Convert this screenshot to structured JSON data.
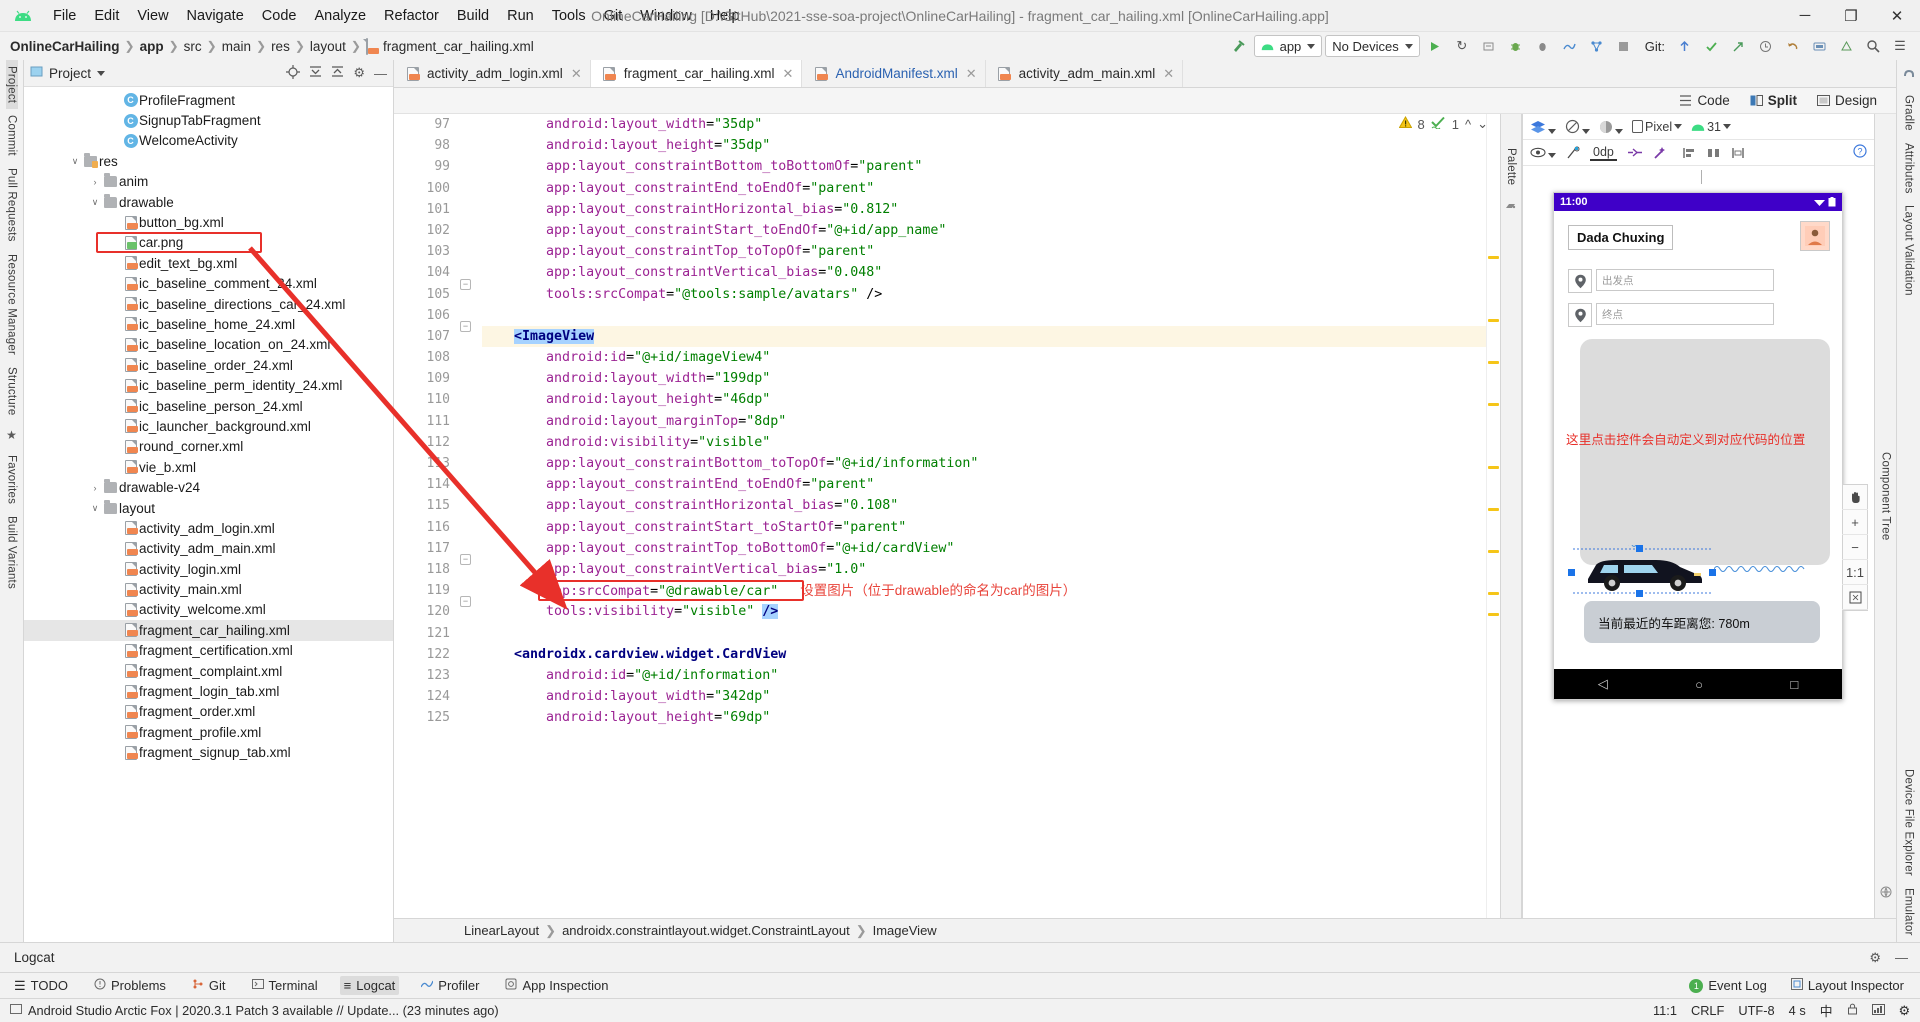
{
  "window": {
    "title": "OnlineCarHailing [D:\\GitHub\\2021-sse-soa-project\\OnlineCarHailing] - fragment_car_hailing.xml [OnlineCarHailing.app]",
    "minimize": "─",
    "maximize": "❐",
    "close": "✕"
  },
  "menu": [
    "File",
    "Edit",
    "View",
    "Navigate",
    "Code",
    "Analyze",
    "Refactor",
    "Build",
    "Run",
    "Tools",
    "Git",
    "Window",
    "Help"
  ],
  "breadcrumb": [
    "OnlineCarHailing",
    "app",
    "src",
    "main",
    "res",
    "layout",
    "fragment_car_hailing.xml"
  ],
  "toolbar": {
    "module_selector": "app",
    "device_selector": "No Devices",
    "git_label": "Git:"
  },
  "project_panel": {
    "title": "Project",
    "tree": [
      {
        "indent": 4,
        "arrow": "",
        "icon": "class-icon",
        "label": "ProfileFragment"
      },
      {
        "indent": 4,
        "arrow": "",
        "icon": "class-icon",
        "label": "SignupTabFragment"
      },
      {
        "indent": 4,
        "arrow": "",
        "icon": "class-icon",
        "label": "WelcomeActivity"
      },
      {
        "indent": 2,
        "arrow": "∨",
        "icon": "res-folder-icon",
        "label": "res"
      },
      {
        "indent": 3,
        "arrow": "›",
        "icon": "folder-icon",
        "label": "anim"
      },
      {
        "indent": 3,
        "arrow": "∨",
        "icon": "folder-icon",
        "label": "drawable"
      },
      {
        "indent": 4,
        "arrow": "",
        "icon": "xml-file-icon",
        "label": "button_bg.xml"
      },
      {
        "indent": 4,
        "arrow": "",
        "icon": "png-file-icon",
        "label": "car.png",
        "highlight": true
      },
      {
        "indent": 4,
        "arrow": "",
        "icon": "xml-file-icon",
        "label": "edit_text_bg.xml"
      },
      {
        "indent": 4,
        "arrow": "",
        "icon": "xml-file-icon",
        "label": "ic_baseline_comment_24.xml"
      },
      {
        "indent": 4,
        "arrow": "",
        "icon": "xml-file-icon",
        "label": "ic_baseline_directions_car_24.xml"
      },
      {
        "indent": 4,
        "arrow": "",
        "icon": "xml-file-icon",
        "label": "ic_baseline_home_24.xml"
      },
      {
        "indent": 4,
        "arrow": "",
        "icon": "xml-file-icon",
        "label": "ic_baseline_location_on_24.xml"
      },
      {
        "indent": 4,
        "arrow": "",
        "icon": "xml-file-icon",
        "label": "ic_baseline_order_24.xml"
      },
      {
        "indent": 4,
        "arrow": "",
        "icon": "xml-file-icon",
        "label": "ic_baseline_perm_identity_24.xml"
      },
      {
        "indent": 4,
        "arrow": "",
        "icon": "xml-file-icon",
        "label": "ic_baseline_person_24.xml"
      },
      {
        "indent": 4,
        "arrow": "",
        "icon": "xml-file-icon",
        "label": "ic_launcher_background.xml"
      },
      {
        "indent": 4,
        "arrow": "",
        "icon": "xml-file-icon",
        "label": "round_corner.xml"
      },
      {
        "indent": 4,
        "arrow": "",
        "icon": "xml-file-icon",
        "label": "vie_b.xml"
      },
      {
        "indent": 3,
        "arrow": "›",
        "icon": "folder-icon",
        "label": "drawable-v24"
      },
      {
        "indent": 3,
        "arrow": "∨",
        "icon": "folder-icon",
        "label": "layout"
      },
      {
        "indent": 4,
        "arrow": "",
        "icon": "xml-file-icon",
        "label": "activity_adm_login.xml"
      },
      {
        "indent": 4,
        "arrow": "",
        "icon": "xml-file-icon",
        "label": "activity_adm_main.xml"
      },
      {
        "indent": 4,
        "arrow": "",
        "icon": "xml-file-icon",
        "label": "activity_login.xml"
      },
      {
        "indent": 4,
        "arrow": "",
        "icon": "xml-file-icon",
        "label": "activity_main.xml"
      },
      {
        "indent": 4,
        "arrow": "",
        "icon": "xml-file-icon",
        "label": "activity_welcome.xml"
      },
      {
        "indent": 4,
        "arrow": "",
        "icon": "xml-file-icon",
        "label": "fragment_car_hailing.xml",
        "selected": true
      },
      {
        "indent": 4,
        "arrow": "",
        "icon": "xml-file-icon",
        "label": "fragment_certification.xml"
      },
      {
        "indent": 4,
        "arrow": "",
        "icon": "xml-file-icon",
        "label": "fragment_complaint.xml"
      },
      {
        "indent": 4,
        "arrow": "",
        "icon": "xml-file-icon",
        "label": "fragment_login_tab.xml"
      },
      {
        "indent": 4,
        "arrow": "",
        "icon": "xml-file-icon",
        "label": "fragment_order.xml"
      },
      {
        "indent": 4,
        "arrow": "",
        "icon": "xml-file-icon",
        "label": "fragment_profile.xml"
      },
      {
        "indent": 4,
        "arrow": "",
        "icon": "xml-file-icon",
        "label": "fragment_signup_tab.xml"
      }
    ]
  },
  "left_rail": [
    "Project",
    "Commit",
    "Pull Requests",
    "Resource Manager",
    "Structure",
    "Favorites",
    "Build Variants"
  ],
  "right_rail": [
    "Gradle",
    "Attributes",
    "Layout Validation",
    "Device File Explorer",
    "Emulator"
  ],
  "editor_tabs": [
    {
      "label": "activity_adm_login.xml",
      "active": false
    },
    {
      "label": "fragment_car_hailing.xml",
      "active": true
    },
    {
      "label": "AndroidManifest.xml",
      "active": false,
      "blue": true
    },
    {
      "label": "activity_adm_main.xml",
      "active": false
    }
  ],
  "view_modes": [
    {
      "label": "Code",
      "active": false
    },
    {
      "label": "Split",
      "active": true
    },
    {
      "label": "Design",
      "active": false
    }
  ],
  "inspections": {
    "warning_count": "8",
    "check_count": "1"
  },
  "code": {
    "first_line": 97,
    "lines": [
      {
        "n": 97,
        "indent": 8,
        "parts": [
          {
            "t": "attr",
            "v": "android:layout_width"
          },
          {
            "t": "eq",
            "v": "="
          },
          {
            "t": "val",
            "v": "\"35dp\""
          }
        ]
      },
      {
        "n": 98,
        "indent": 8,
        "parts": [
          {
            "t": "attr",
            "v": "android:layout_height"
          },
          {
            "t": "eq",
            "v": "="
          },
          {
            "t": "val",
            "v": "\"35dp\""
          }
        ]
      },
      {
        "n": 99,
        "indent": 8,
        "parts": [
          {
            "t": "attr",
            "v": "app:layout_constraintBottom_toBottomOf"
          },
          {
            "t": "eq",
            "v": "="
          },
          {
            "t": "val",
            "v": "\"parent\""
          }
        ]
      },
      {
        "n": 100,
        "indent": 8,
        "parts": [
          {
            "t": "attr",
            "v": "app:layout_constraintEnd_toEndOf"
          },
          {
            "t": "eq",
            "v": "="
          },
          {
            "t": "val",
            "v": "\"parent\""
          }
        ]
      },
      {
        "n": 101,
        "indent": 8,
        "parts": [
          {
            "t": "attr",
            "v": "app:layout_constraintHorizontal_bias"
          },
          {
            "t": "eq",
            "v": "="
          },
          {
            "t": "val",
            "v": "\"0.812\""
          }
        ]
      },
      {
        "n": 102,
        "indent": 8,
        "parts": [
          {
            "t": "attr",
            "v": "app:layout_constraintStart_toEndOf"
          },
          {
            "t": "eq",
            "v": "="
          },
          {
            "t": "val",
            "v": "\"@+id/app_name\""
          }
        ]
      },
      {
        "n": 103,
        "indent": 8,
        "parts": [
          {
            "t": "attr",
            "v": "app:layout_constraintTop_toTopOf"
          },
          {
            "t": "eq",
            "v": "="
          },
          {
            "t": "val",
            "v": "\"parent\""
          }
        ]
      },
      {
        "n": 104,
        "indent": 8,
        "parts": [
          {
            "t": "attr",
            "v": "app:layout_constraintVertical_bias"
          },
          {
            "t": "eq",
            "v": "="
          },
          {
            "t": "val",
            "v": "\"0.048\""
          }
        ]
      },
      {
        "n": 105,
        "indent": 8,
        "parts": [
          {
            "t": "attr",
            "v": "tools:srcCompat"
          },
          {
            "t": "eq",
            "v": "="
          },
          {
            "t": "val",
            "v": "\"@tools:sample/avatars\""
          },
          {
            "t": "punct",
            "v": " />"
          }
        ]
      },
      {
        "n": 106,
        "indent": 0,
        "parts": []
      },
      {
        "n": 107,
        "indent": 4,
        "highlight": true,
        "parts": [
          {
            "t": "tagsel",
            "v": "<ImageView"
          }
        ]
      },
      {
        "n": 108,
        "indent": 8,
        "parts": [
          {
            "t": "attr",
            "v": "android:id"
          },
          {
            "t": "eq",
            "v": "="
          },
          {
            "t": "val",
            "v": "\"@+id/imageView4\""
          }
        ]
      },
      {
        "n": 109,
        "indent": 8,
        "parts": [
          {
            "t": "attr",
            "v": "android:layout_width"
          },
          {
            "t": "eq",
            "v": "="
          },
          {
            "t": "val",
            "v": "\"199dp\""
          }
        ]
      },
      {
        "n": 110,
        "indent": 8,
        "parts": [
          {
            "t": "attr",
            "v": "android:layout_height"
          },
          {
            "t": "eq",
            "v": "="
          },
          {
            "t": "val",
            "v": "\"46dp\""
          }
        ]
      },
      {
        "n": 111,
        "indent": 8,
        "parts": [
          {
            "t": "attr",
            "v": "android:layout_marginTop"
          },
          {
            "t": "eq",
            "v": "="
          },
          {
            "t": "val",
            "v": "\"8dp\""
          }
        ]
      },
      {
        "n": 112,
        "indent": 8,
        "parts": [
          {
            "t": "attr",
            "v": "android:visibility"
          },
          {
            "t": "eq",
            "v": "="
          },
          {
            "t": "val",
            "v": "\"visible\""
          }
        ]
      },
      {
        "n": 113,
        "indent": 8,
        "parts": [
          {
            "t": "attr",
            "v": "app:layout_constraintBottom_toTopOf"
          },
          {
            "t": "eq",
            "v": "="
          },
          {
            "t": "val",
            "v": "\"@+id/information\""
          }
        ]
      },
      {
        "n": 114,
        "indent": 8,
        "parts": [
          {
            "t": "attr",
            "v": "app:layout_constraintEnd_toEndOf"
          },
          {
            "t": "eq",
            "v": "="
          },
          {
            "t": "val",
            "v": "\"parent\""
          }
        ]
      },
      {
        "n": 115,
        "indent": 8,
        "parts": [
          {
            "t": "attr",
            "v": "app:layout_constraintHorizontal_bias"
          },
          {
            "t": "eq",
            "v": "="
          },
          {
            "t": "val",
            "v": "\"0.108\""
          }
        ]
      },
      {
        "n": 116,
        "indent": 8,
        "parts": [
          {
            "t": "attr",
            "v": "app:layout_constraintStart_toStartOf"
          },
          {
            "t": "eq",
            "v": "="
          },
          {
            "t": "val",
            "v": "\"parent\""
          }
        ]
      },
      {
        "n": 117,
        "indent": 8,
        "parts": [
          {
            "t": "attr",
            "v": "app:layout_constraintTop_toBottomOf"
          },
          {
            "t": "eq",
            "v": "="
          },
          {
            "t": "val",
            "v": "\"@+id/cardView\""
          }
        ]
      },
      {
        "n": 118,
        "indent": 8,
        "parts": [
          {
            "t": "attr",
            "v": "app:layout_constraintVertical_bias"
          },
          {
            "t": "eq",
            "v": "="
          },
          {
            "t": "val",
            "v": "\"1.0\""
          }
        ]
      },
      {
        "n": 119,
        "indent": 8,
        "boxed": true,
        "parts": [
          {
            "t": "attr",
            "v": "app:srcCompat"
          },
          {
            "t": "eq",
            "v": "="
          },
          {
            "t": "val",
            "v": "\"@drawable/car\""
          }
        ]
      },
      {
        "n": 120,
        "indent": 8,
        "parts": [
          {
            "t": "attr",
            "v": "tools:visibility"
          },
          {
            "t": "eq",
            "v": "="
          },
          {
            "t": "val",
            "v": "\"visible\""
          },
          {
            "t": "punct",
            "v": " "
          },
          {
            "t": "selpunct",
            "v": "/>"
          }
        ]
      },
      {
        "n": 121,
        "indent": 0,
        "parts": []
      },
      {
        "n": 122,
        "indent": 4,
        "parts": [
          {
            "t": "tag",
            "v": "<androidx.cardview.widget.CardView"
          }
        ]
      },
      {
        "n": 123,
        "indent": 8,
        "parts": [
          {
            "t": "attr",
            "v": "android:id"
          },
          {
            "t": "eq",
            "v": "="
          },
          {
            "t": "val",
            "v": "\"@+id/information\""
          }
        ]
      },
      {
        "n": 124,
        "indent": 8,
        "parts": [
          {
            "t": "attr",
            "v": "android:layout_width"
          },
          {
            "t": "eq",
            "v": "="
          },
          {
            "t": "val",
            "v": "\"342dp\""
          }
        ]
      },
      {
        "n": 125,
        "indent": 8,
        "parts": [
          {
            "t": "attr",
            "v": "android:layout_height"
          },
          {
            "t": "eq",
            "v": "="
          },
          {
            "t": "val",
            "v": "\"69dp\""
          }
        ]
      }
    ],
    "inline_comment": "设置图片（位于drawable的命名为car的图片）"
  },
  "editor_breadcrumbs": [
    "LinearLayout",
    "androidx.constraintlayout.widget.ConstraintLayout",
    "ImageView"
  ],
  "design": {
    "toolbar": {
      "device": "Pixel",
      "api": "31",
      "margin": "0dp"
    },
    "palette_label": "Palette",
    "component_tree_label": "Component Tree",
    "preview": {
      "status_time": "11:00",
      "app_title": "Dada Chuxing",
      "start_placeholder": "出发点",
      "end_placeholder": "终点",
      "annotation": "这里点击控件会自动定义到对应代码的位置",
      "card_text": "当前最近的车距离您: 780m",
      "zoom_controls": [
        "+",
        "−",
        "1:1"
      ]
    }
  },
  "logcat": {
    "title": "Logcat"
  },
  "tool_windows": [
    {
      "label": "TODO",
      "icon": "todo-icon"
    },
    {
      "label": "Problems",
      "icon": "problems-icon"
    },
    {
      "label": "Git",
      "icon": "git-icon"
    },
    {
      "label": "Terminal",
      "icon": "terminal-icon"
    },
    {
      "label": "Logcat",
      "icon": "logcat-icon",
      "active": true
    },
    {
      "label": "Profiler",
      "icon": "profiler-icon"
    },
    {
      "label": "App Inspection",
      "icon": "app-inspection-icon"
    }
  ],
  "tool_windows_right": [
    {
      "label": "Event Log",
      "icon": "event-log-icon",
      "badge": "1"
    },
    {
      "label": "Layout Inspector",
      "icon": "layout-inspector-icon"
    }
  ],
  "statusbar": {
    "message": "Android Studio Arctic Fox | 2020.3.1 Patch 3 available // Update... (23 minutes ago)",
    "caret": "11:1",
    "line_sep": "CRLF",
    "encoding": "UTF-8",
    "indent": "4 s",
    "lang": "中",
    "lock": "🔒"
  },
  "colors": {
    "accent_blue": "#1a73e8",
    "annotation_red": "#e8302a",
    "status_purple": "#3f00c8",
    "android_green": "#3ddc84",
    "warning_yellow": "#f5c518"
  }
}
